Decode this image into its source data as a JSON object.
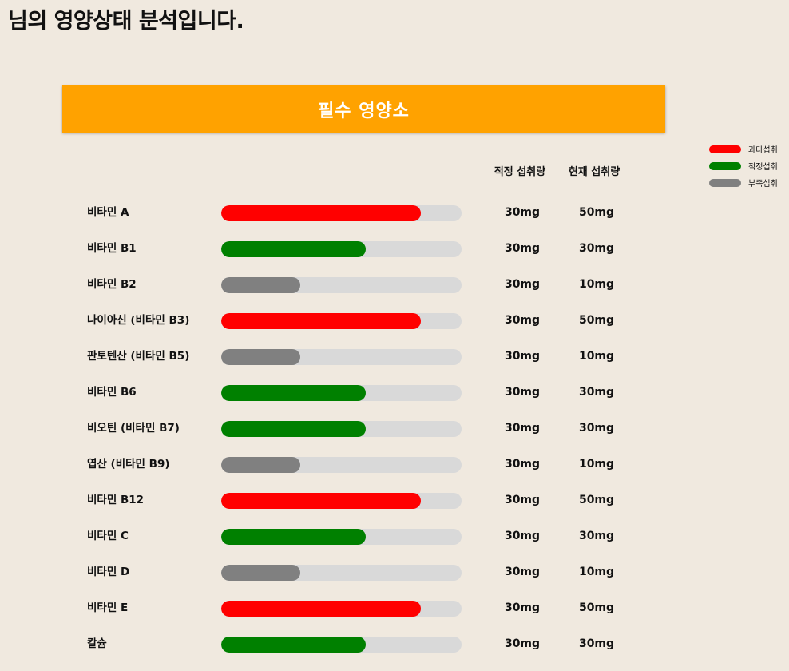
{
  "title": "님의 영양상태 분석입니다.",
  "section": {
    "title": "필수 영양소"
  },
  "legend": [
    {
      "label": "과다섭취",
      "color": "#ff0000"
    },
    {
      "label": "적정섭취",
      "color": "#008000"
    },
    {
      "label": "부족섭취",
      "color": "#808080"
    }
  ],
  "columns": {
    "recommended": "적정 섭취량",
    "current": "현재 섭취량"
  },
  "status_colors": {
    "over": "#ff0000",
    "adequate": "#008000",
    "under": "#808080"
  },
  "nutrients": [
    {
      "name": "비타민 A",
      "status": "over",
      "level": 0.83,
      "recommended": "30mg",
      "current": "50mg"
    },
    {
      "name": "비타민 B1",
      "status": "adequate",
      "level": 0.6,
      "recommended": "30mg",
      "current": "30mg"
    },
    {
      "name": "비타민 B2",
      "status": "under",
      "level": 0.33,
      "recommended": "30mg",
      "current": "10mg"
    },
    {
      "name": "나이아신 (비타민 B3)",
      "status": "over",
      "level": 0.83,
      "recommended": "30mg",
      "current": "50mg"
    },
    {
      "name": "판토텐산 (비타민 B5)",
      "status": "under",
      "level": 0.33,
      "recommended": "30mg",
      "current": "10mg"
    },
    {
      "name": "비타민 B6",
      "status": "adequate",
      "level": 0.6,
      "recommended": "30mg",
      "current": "30mg"
    },
    {
      "name": "비오틴 (비타민 B7)",
      "status": "adequate",
      "level": 0.6,
      "recommended": "30mg",
      "current": "30mg"
    },
    {
      "name": "엽산 (비타민 B9)",
      "status": "under",
      "level": 0.33,
      "recommended": "30mg",
      "current": "10mg"
    },
    {
      "name": "비타민 B12",
      "status": "over",
      "level": 0.83,
      "recommended": "30mg",
      "current": "50mg"
    },
    {
      "name": "비타민 C",
      "status": "adequate",
      "level": 0.6,
      "recommended": "30mg",
      "current": "30mg"
    },
    {
      "name": "비타민 D",
      "status": "under",
      "level": 0.33,
      "recommended": "30mg",
      "current": "10mg"
    },
    {
      "name": "비타민 E",
      "status": "over",
      "level": 0.83,
      "recommended": "30mg",
      "current": "50mg"
    },
    {
      "name": "칼슘",
      "status": "adequate",
      "level": 0.6,
      "recommended": "30mg",
      "current": "30mg"
    }
  ]
}
